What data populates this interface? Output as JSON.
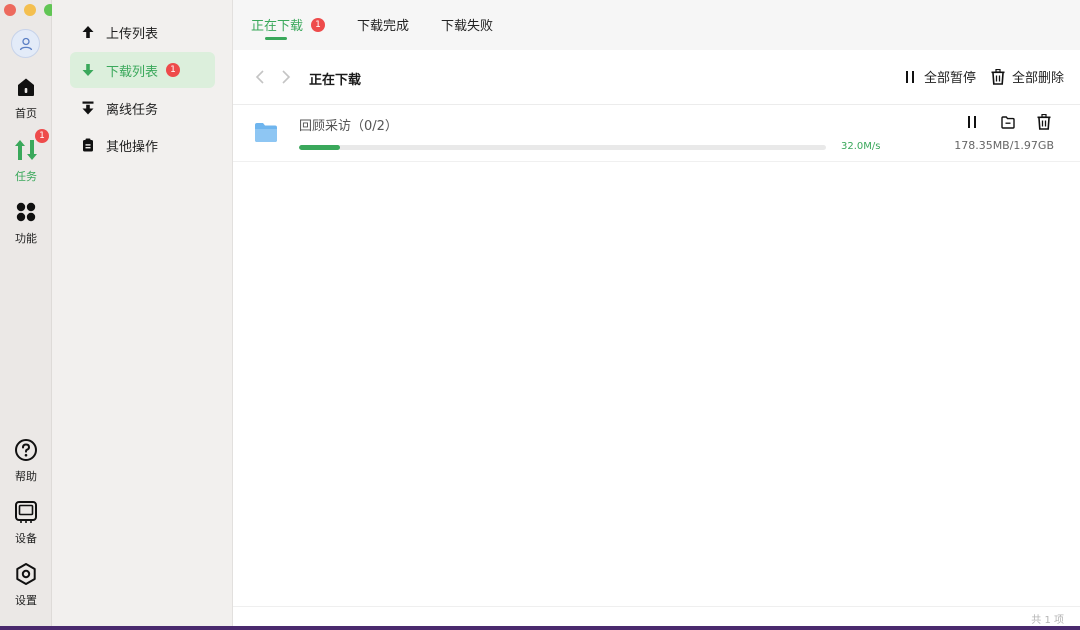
{
  "rail": {
    "items": [
      {
        "label": "首页",
        "icon": "home-icon"
      },
      {
        "label": "任务",
        "icon": "transfer-icon",
        "badge": "1"
      },
      {
        "label": "功能",
        "icon": "grid-icon"
      },
      {
        "label": "帮助",
        "icon": "help-icon"
      },
      {
        "label": "设备",
        "icon": "device-icon"
      },
      {
        "label": "设置",
        "icon": "settings-icon"
      }
    ]
  },
  "sidebar": {
    "items": [
      {
        "label": "上传列表",
        "icon": "upload-icon"
      },
      {
        "label": "下载列表",
        "icon": "download-icon",
        "badge": "1"
      },
      {
        "label": "离线任务",
        "icon": "offline-icon"
      },
      {
        "label": "其他操作",
        "icon": "clipboard-icon"
      }
    ]
  },
  "tabs": [
    {
      "label": "正在下载",
      "badge": "1"
    },
    {
      "label": "下载完成"
    },
    {
      "label": "下载失败"
    }
  ],
  "toolbar": {
    "title": "正在下载",
    "pause_all": "全部暂停",
    "delete_all": "全部删除"
  },
  "tasks": [
    {
      "name": "回顾采访（0/2）",
      "speed": "32.0M/s",
      "size": "178.35MB/1.97GB",
      "progress": 0.077
    }
  ],
  "footer": {
    "count": "共 1 项"
  },
  "colors": {
    "accent": "#3aa85b",
    "badge": "#ee4b4b",
    "folder": "#6fb5ee"
  }
}
